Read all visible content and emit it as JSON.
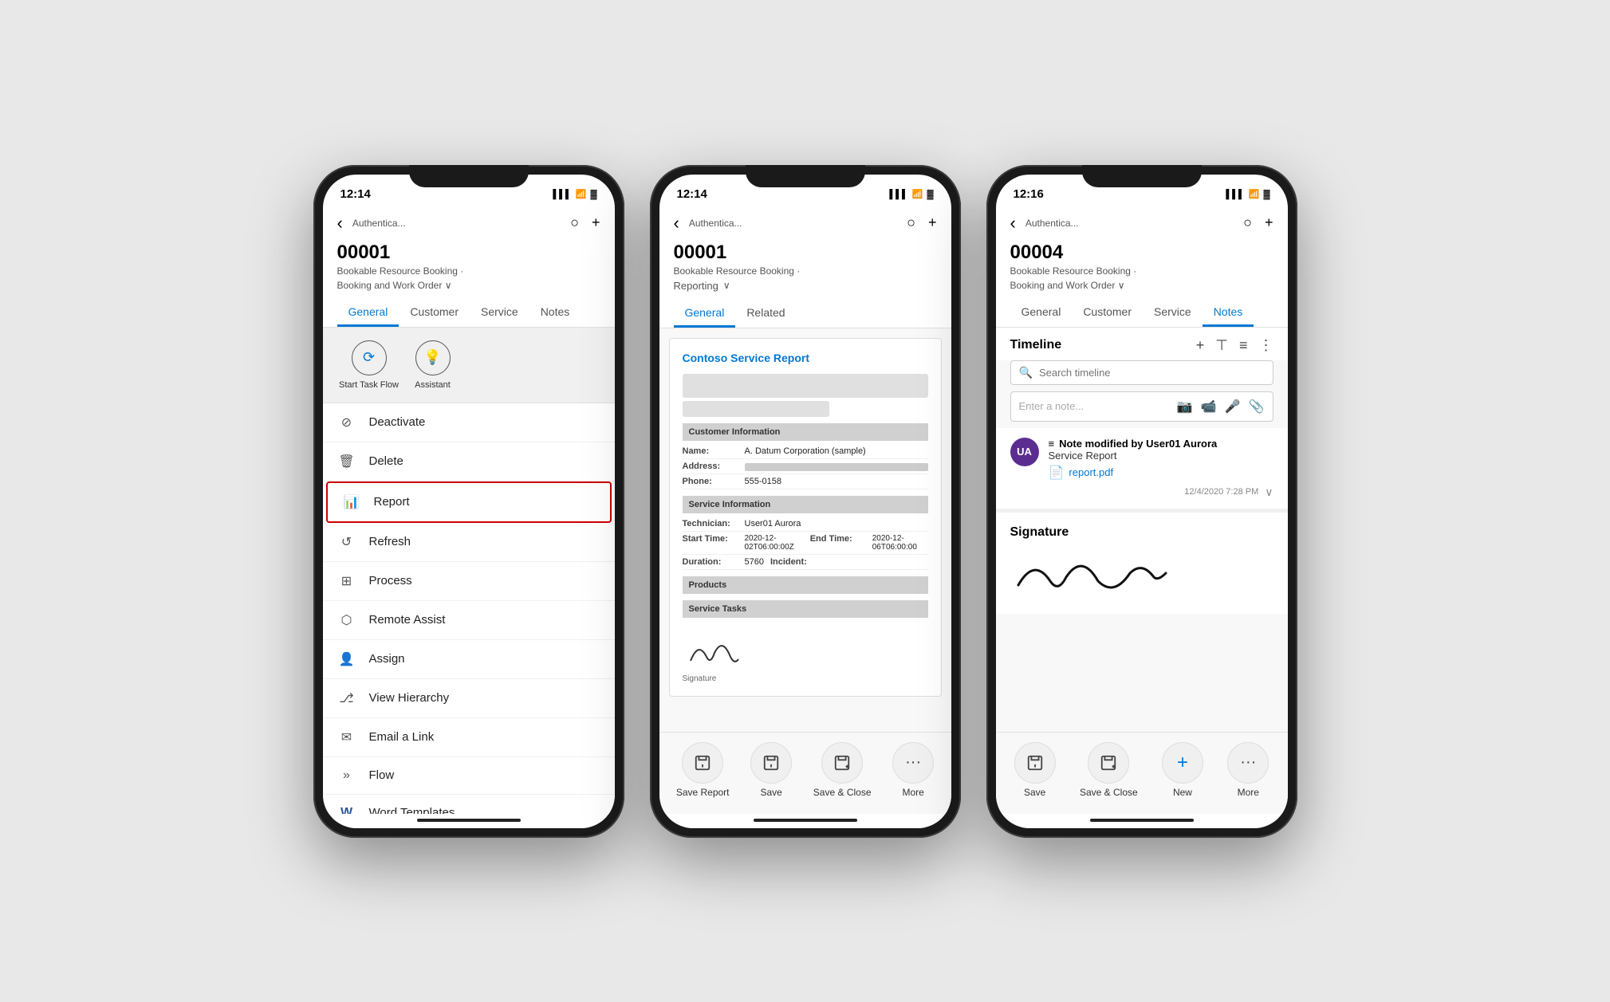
{
  "phone1": {
    "status": {
      "time": "12:14",
      "carrier": "Authentica...",
      "signal": "▌▌▌",
      "wifi": "WiFi",
      "battery": "🔋"
    },
    "nav": {
      "back": "‹",
      "title": "Authentica...",
      "search": "○",
      "add": "+"
    },
    "record": {
      "id": "00001",
      "line1": "Bookable Resource Booking ·",
      "line2": "Booking and Work Order",
      "chevron": "∨"
    },
    "tabs": [
      {
        "label": "General",
        "active": true
      },
      {
        "label": "Customer",
        "active": false
      },
      {
        "label": "Service",
        "active": false
      },
      {
        "label": "Notes",
        "active": false
      }
    ],
    "quickActions": [
      {
        "icon": "⟳",
        "label": "Start Task Flow"
      },
      {
        "icon": "💡",
        "label": "Assistant"
      }
    ],
    "menuItems": [
      {
        "icon": "⊘",
        "label": "Deactivate"
      },
      {
        "icon": "🗑",
        "label": "Delete"
      },
      {
        "icon": "📊",
        "label": "Report",
        "highlighted": true
      },
      {
        "icon": "↺",
        "label": "Refresh"
      },
      {
        "icon": "⊞",
        "label": "Process"
      },
      {
        "icon": "⬡",
        "label": "Remote Assist"
      },
      {
        "icon": "👤",
        "label": "Assign"
      },
      {
        "icon": "⎇",
        "label": "View Hierarchy"
      },
      {
        "icon": "✉",
        "label": "Email a Link"
      },
      {
        "icon": "»",
        "label": "Flow"
      },
      {
        "icon": "W",
        "label": "Word Templates"
      }
    ]
  },
  "phone2": {
    "status": {
      "time": "12:14",
      "carrier": "Authentica..."
    },
    "nav": {
      "back": "‹",
      "title": "Authentica...",
      "search": "○",
      "add": "+"
    },
    "record": {
      "id": "00001",
      "line1": "Bookable Resource Booking ·",
      "reporting": "Reporting",
      "chevron": "∨"
    },
    "tabs": [
      {
        "label": "General",
        "active": true
      },
      {
        "label": "Related",
        "active": false
      }
    ],
    "report": {
      "title": "Contoso Service Report",
      "customerSection": "Customer Information",
      "nameLabel": "Name:",
      "nameValue": "A. Datum Corporation (sample)",
      "addressLabel": "Address:",
      "phoneLabel": "Phone:",
      "phoneValue": "555-0158",
      "serviceSection": "Service Information",
      "techLabel": "Technician:",
      "techValue": "User01 Aurora",
      "startLabel": "Start Time:",
      "startValue": "2020-12-02T06:00:00Z",
      "endLabel": "End Time:",
      "endValue": "2020-12-06T06:00:00",
      "durationLabel": "Duration:",
      "durationValue": "5760",
      "incidentLabel": "Incident:",
      "productsSection": "Products",
      "tasksSection": "Service Tasks",
      "signatureLabel": "Signature"
    },
    "actionBar": [
      {
        "icon": "💾",
        "label": "Save Report"
      },
      {
        "icon": "💾",
        "label": "Save"
      },
      {
        "icon": "💾",
        "label": "Save & Close"
      },
      {
        "icon": "···",
        "label": "More"
      }
    ]
  },
  "phone3": {
    "status": {
      "time": "12:16",
      "carrier": "Authentica..."
    },
    "nav": {
      "back": "‹",
      "title": "Authentica...",
      "search": "○",
      "add": "+"
    },
    "record": {
      "id": "00004",
      "line1": "Bookable Resource Booking ·",
      "line2": "Booking and Work Order",
      "chevron": "∨"
    },
    "tabs": [
      {
        "label": "General",
        "active": false
      },
      {
        "label": "Customer",
        "active": false
      },
      {
        "label": "Service",
        "active": false
      },
      {
        "label": "Notes",
        "active": true
      }
    ],
    "timeline": {
      "title": "Timeline",
      "searchPlaceholder": "Search timeline",
      "notePlaceholder": "Enter a note...",
      "noteIcons": [
        "📷",
        "📹",
        "🎤",
        "📎"
      ]
    },
    "noteItem": {
      "avatar": "UA",
      "titlePrefix": "≡",
      "title": "Note modified by User01 Aurora",
      "subtitle": "Service Report",
      "attachment": "report.pdf",
      "timestamp": "12/4/2020 7:28 PM"
    },
    "signature": {
      "title": "Signature"
    },
    "actionBar": [
      {
        "icon": "💾",
        "label": "Save"
      },
      {
        "icon": "💾",
        "label": "Save & Close"
      },
      {
        "icon": "+",
        "label": "New"
      },
      {
        "icon": "···",
        "label": "More"
      }
    ]
  }
}
